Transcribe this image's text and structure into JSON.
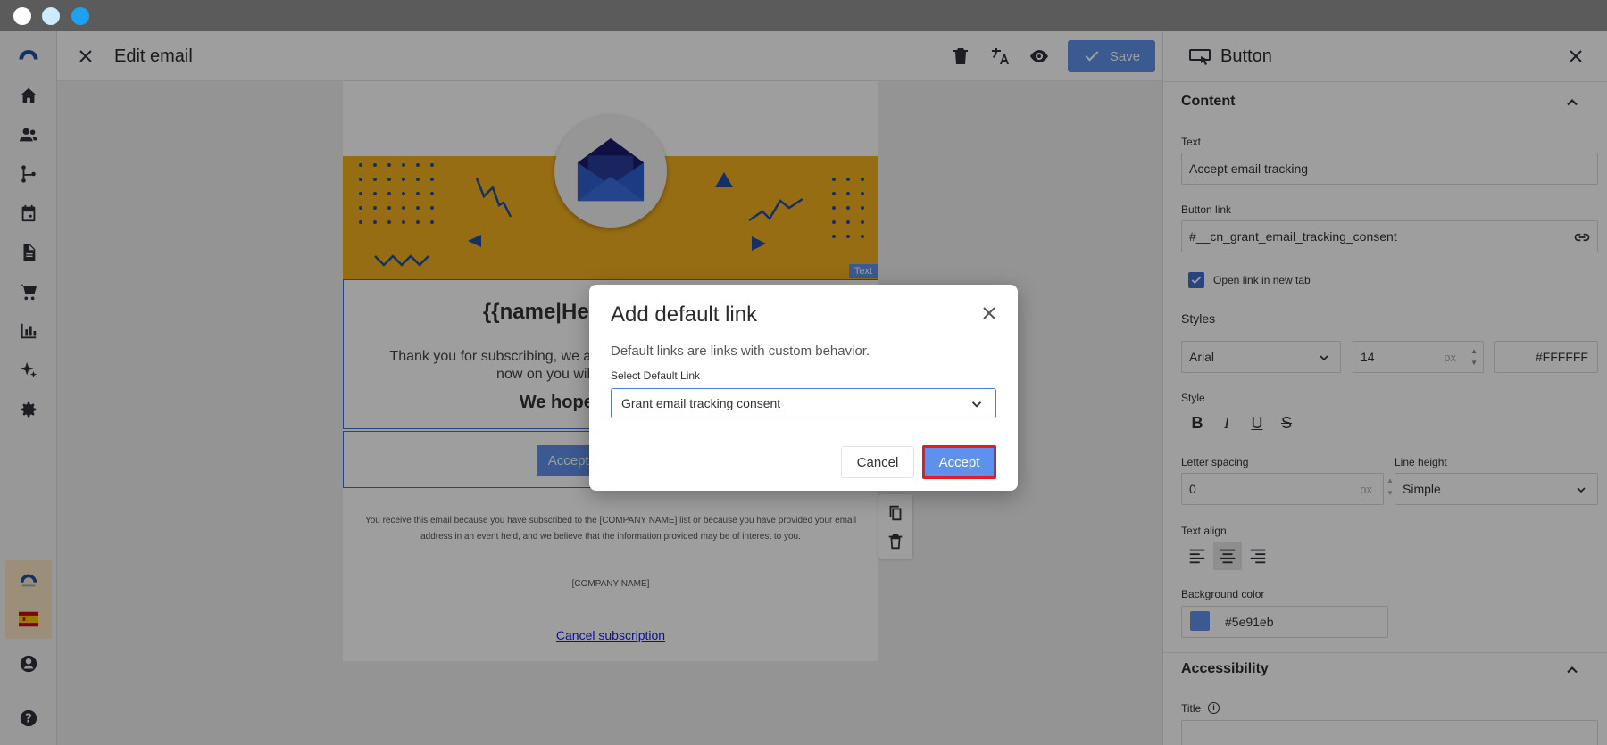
{
  "header": {
    "title": "Edit email",
    "save_label": "Save"
  },
  "email": {
    "text_tag": "Text",
    "greeting": "{{name|Hello}}, welcome!",
    "thanks": "Thank you for subscribing, we are delighted to have you with us. From now on you will receive all the news.",
    "hope": "We hope you enjoy it!",
    "button_label": "Accept email tracking",
    "footer_note": "You receive this email because you have subscribed to the [COMPANY NAME] list or because you have provided your email address in an event held, and we believe that the information provided may be of interest to you.",
    "company": "[COMPANY NAME]",
    "unsubscribe": "Cancel subscription"
  },
  "panel": {
    "title": "Button",
    "content_section": "Content",
    "text_label": "Text",
    "text_value": "Accept email tracking",
    "link_label": "Button link",
    "link_value": "#__cn_grant_email_tracking_consent",
    "new_tab_label": "Open link in new tab",
    "styles_label": "Styles",
    "font_value": "Arial",
    "size_value": "14",
    "size_unit": "px",
    "color_value": "#FFFFFF",
    "style_label": "Style",
    "style_bold": "B",
    "style_italic": "I",
    "style_underline": "U",
    "style_strike": "S",
    "letter_spacing_label": "Letter spacing",
    "letter_spacing_value": "0",
    "letter_spacing_unit": "px",
    "line_height_label": "Line height",
    "line_height_value": "Simple",
    "text_align_label": "Text align",
    "bg_color_label": "Background color",
    "bg_color_value": "#5e91eb",
    "accessibility_section": "Accessibility",
    "title_label": "Title"
  },
  "modal": {
    "title": "Add default link",
    "description": "Default links are links with custom behavior.",
    "select_label": "Select Default Link",
    "select_value": "Grant email tracking consent",
    "cancel_label": "Cancel",
    "accept_label": "Accept"
  },
  "colors": {
    "accent": "#5e91eb",
    "banner": "#f2b01e",
    "highlight_border": "#e11d1d"
  }
}
